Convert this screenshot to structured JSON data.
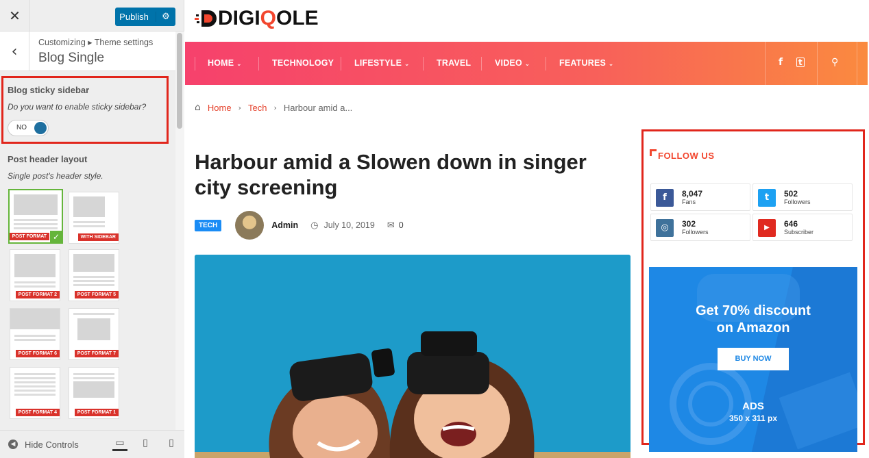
{
  "customizer": {
    "close_glyph": "✕",
    "publish_label": "Publish",
    "breadcrumb": "Customizing ▸ Theme settings",
    "section_title": "Blog Single",
    "sticky_sidebar": {
      "label": "Blog sticky sidebar",
      "description": "Do you want to enable sticky sidebar?",
      "toggle_text": "NO",
      "enabled": false
    },
    "post_header": {
      "label": "Post header layout",
      "description": "Single post's header style.",
      "layouts": [
        {
          "tag": "POST FORMAT",
          "selected": true
        },
        {
          "tag": "WITH SIDEBAR",
          "selected": false
        },
        {
          "tag": "POST FORMAT 2",
          "selected": false
        },
        {
          "tag": "POST FORMAT 5",
          "selected": false
        },
        {
          "tag": "POST FORMAT 6",
          "selected": false
        },
        {
          "tag": "POST FORMAT 7",
          "selected": false
        },
        {
          "tag": "POST FORMAT 4",
          "selected": false
        },
        {
          "tag": "POST FORMAT 1",
          "selected": false
        }
      ]
    },
    "footer": {
      "hide_controls": "Hide Controls",
      "devices": [
        "desktop-icon",
        "tablet-icon",
        "mobile-icon"
      ],
      "active_device": "desktop-icon"
    }
  },
  "site": {
    "logo_text_a": "DIGI",
    "logo_text_q": "Q",
    "logo_text_b": "OLE",
    "nav": [
      {
        "label": "HOME",
        "dropdown": true
      },
      {
        "label": "TECHNOLOGY",
        "dropdown": false
      },
      {
        "label": "LIFESTYLE",
        "dropdown": true
      },
      {
        "label": "TRAVEL",
        "dropdown": false
      },
      {
        "label": "VIDEO",
        "dropdown": true
      },
      {
        "label": "FEATURES",
        "dropdown": true
      }
    ],
    "nav_icons": [
      "facebook-icon",
      "twitter-icon",
      "search-icon"
    ],
    "breadcrumb": [
      "Home",
      "Tech",
      "Harbour amid a..."
    ],
    "post": {
      "title": "Harbour amid a Slowen down in singer city screening",
      "category": "TECH",
      "author": "Admin",
      "date": "July 10, 2019",
      "comments": "0"
    },
    "sidebar": {
      "follow_title": "FOLLOW US",
      "social": [
        {
          "network": "facebook",
          "icon": "f",
          "count": "8,047",
          "unit": "Fans",
          "color": "#3b5998"
        },
        {
          "network": "twitter",
          "icon": "t",
          "count": "502",
          "unit": "Followers",
          "color": "#1da1f2"
        },
        {
          "network": "instagram",
          "icon": "◎",
          "count": "302",
          "unit": "Followers",
          "color": "#3f729b"
        },
        {
          "network": "youtube",
          "icon": "▶",
          "count": "646",
          "unit": "Subscriber",
          "color": "#e02a20"
        }
      ],
      "ad": {
        "headline_line1": "Get 70% discount",
        "headline_line2": "on Amazon",
        "button": "BUY NOW",
        "label": "ADS",
        "size": "350 x 311 px"
      }
    }
  },
  "colors": {
    "accent": "#f2462e",
    "highlight_box": "#e1261c",
    "wp_blue": "#0073aa"
  }
}
